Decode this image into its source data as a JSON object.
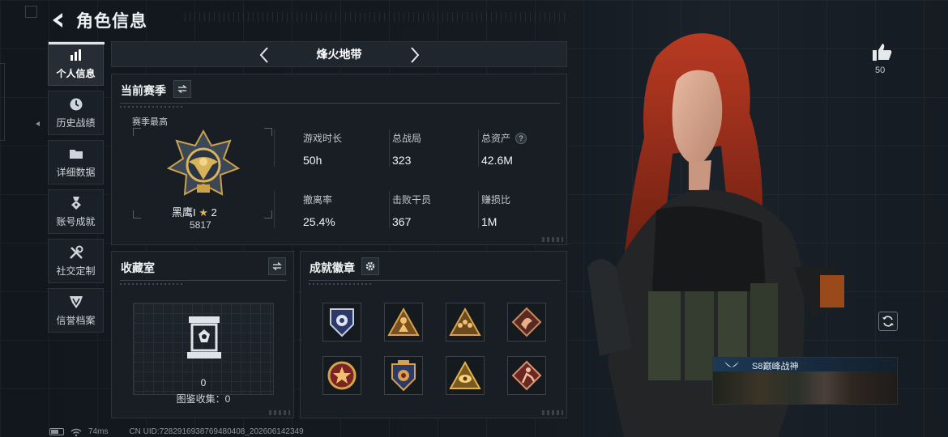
{
  "header": {
    "title": "角色信息"
  },
  "sidebar": {
    "items": [
      {
        "label": "个人信息",
        "icon": "bar-chart-icon",
        "active": true
      },
      {
        "label": "历史战绩",
        "icon": "clock-icon"
      },
      {
        "label": "详细数据",
        "icon": "folder-icon"
      },
      {
        "label": "账号成就",
        "icon": "medal-icon"
      },
      {
        "label": "社交定制",
        "icon": "tools-icon"
      },
      {
        "label": "信誉档案",
        "icon": "shield-icon"
      }
    ]
  },
  "mode": {
    "title": "烽火地带"
  },
  "season": {
    "title": "当前赛季",
    "subtitle": "赛季最高",
    "rank_name": "黑鹰I",
    "rank_stars": "2",
    "rank_points": "5817",
    "stats": [
      {
        "label": "游戏时长",
        "value": "50h"
      },
      {
        "label": "总战局",
        "value": "323"
      },
      {
        "label": "总资产",
        "value": "42.6M",
        "help": "?"
      },
      {
        "label": "撤离率",
        "value": "25.4%"
      },
      {
        "label": "击败干员",
        "value": "367"
      },
      {
        "label": "赚损比",
        "value": "1M"
      }
    ]
  },
  "collection": {
    "title": "收藏室",
    "count": "0",
    "label": "图鉴收集：0"
  },
  "achievements": {
    "title": "成就徽章",
    "badges": [
      "lion-shield-badge-icon",
      "soldier-triangle-badge-icon",
      "team-triangle-badge-icon",
      "dragon-diamond-badge-icon",
      "star-round-badge-icon",
      "eagle-shield-badge-icon",
      "eye-triangle-badge-icon",
      "runner-diamond-badge-icon"
    ]
  },
  "right": {
    "likes": "50",
    "banner_title": "S8巅峰战神"
  },
  "footer": {
    "ping": "74ms",
    "uid": "CN UID:7282916938769480408_202606142349"
  },
  "colors": {
    "accent": "#dfe4e8",
    "panel": "#181e24",
    "gold": "#c9a24a"
  }
}
